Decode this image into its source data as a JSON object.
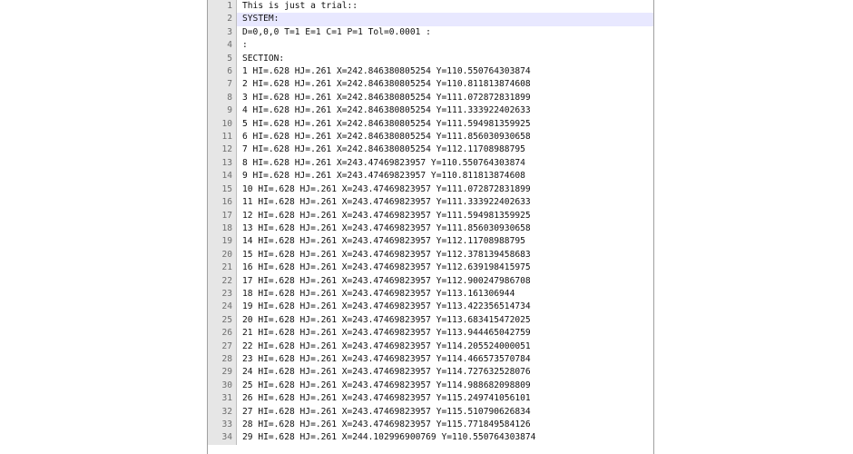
{
  "editor": {
    "active_line_index": 1,
    "lines": [
      {
        "num": "1",
        "text": "This is just a trial::"
      },
      {
        "num": "2",
        "text": "SYSTEM:"
      },
      {
        "num": "3",
        "text": "D=0,0,0 T=1 E=1 C=1 P=1 Tol=0.0001 :"
      },
      {
        "num": "4",
        "text": ":"
      },
      {
        "num": "5",
        "text": "SECTION:"
      },
      {
        "num": "6",
        "text": "1 HI=.628 HJ=.261 X=242.846380805254 Y=110.550764303874"
      },
      {
        "num": "7",
        "text": "2 HI=.628 HJ=.261 X=242.846380805254 Y=110.811813874608"
      },
      {
        "num": "8",
        "text": "3 HI=.628 HJ=.261 X=242.846380805254 Y=111.072872831899"
      },
      {
        "num": "9",
        "text": "4 HI=.628 HJ=.261 X=242.846380805254 Y=111.333922402633"
      },
      {
        "num": "10",
        "text": "5 HI=.628 HJ=.261 X=242.846380805254 Y=111.594981359925"
      },
      {
        "num": "11",
        "text": "6 HI=.628 HJ=.261 X=242.846380805254 Y=111.856030930658"
      },
      {
        "num": "12",
        "text": "7 HI=.628 HJ=.261 X=242.846380805254 Y=112.11708988795"
      },
      {
        "num": "13",
        "text": "8 HI=.628 HJ=.261 X=243.47469823957 Y=110.550764303874"
      },
      {
        "num": "14",
        "text": "9 HI=.628 HJ=.261 X=243.47469823957 Y=110.811813874608"
      },
      {
        "num": "15",
        "text": "10 HI=.628 HJ=.261 X=243.47469823957 Y=111.072872831899"
      },
      {
        "num": "16",
        "text": "11 HI=.628 HJ=.261 X=243.47469823957 Y=111.333922402633"
      },
      {
        "num": "17",
        "text": "12 HI=.628 HJ=.261 X=243.47469823957 Y=111.594981359925"
      },
      {
        "num": "18",
        "text": "13 HI=.628 HJ=.261 X=243.47469823957 Y=111.856030930658"
      },
      {
        "num": "19",
        "text": "14 HI=.628 HJ=.261 X=243.47469823957 Y=112.11708988795"
      },
      {
        "num": "20",
        "text": "15 HI=.628 HJ=.261 X=243.47469823957 Y=112.378139458683"
      },
      {
        "num": "21",
        "text": "16 HI=.628 HJ=.261 X=243.47469823957 Y=112.639198415975"
      },
      {
        "num": "22",
        "text": "17 HI=.628 HJ=.261 X=243.47469823957 Y=112.900247986708"
      },
      {
        "num": "23",
        "text": "18 HI=.628 HJ=.261 X=243.47469823957 Y=113.161306944"
      },
      {
        "num": "24",
        "text": "19 HI=.628 HJ=.261 X=243.47469823957 Y=113.422356514734"
      },
      {
        "num": "25",
        "text": "20 HI=.628 HJ=.261 X=243.47469823957 Y=113.683415472025"
      },
      {
        "num": "26",
        "text": "21 HI=.628 HJ=.261 X=243.47469823957 Y=113.944465042759"
      },
      {
        "num": "27",
        "text": "22 HI=.628 HJ=.261 X=243.47469823957 Y=114.205524000051"
      },
      {
        "num": "28",
        "text": "23 HI=.628 HJ=.261 X=243.47469823957 Y=114.466573570784"
      },
      {
        "num": "29",
        "text": "24 HI=.628 HJ=.261 X=243.47469823957 Y=114.727632528076"
      },
      {
        "num": "30",
        "text": "25 HI=.628 HJ=.261 X=243.47469823957 Y=114.988682098809"
      },
      {
        "num": "31",
        "text": "26 HI=.628 HJ=.261 X=243.47469823957 Y=115.249741056101"
      },
      {
        "num": "32",
        "text": "27 HI=.628 HJ=.261 X=243.47469823957 Y=115.510790626834"
      },
      {
        "num": "33",
        "text": "28 HI=.628 HJ=.261 X=243.47469823957 Y=115.771849584126"
      },
      {
        "num": "34",
        "text": "29 HI=.628 HJ=.261 X=244.102996900769 Y=110.550764303874"
      }
    ]
  }
}
